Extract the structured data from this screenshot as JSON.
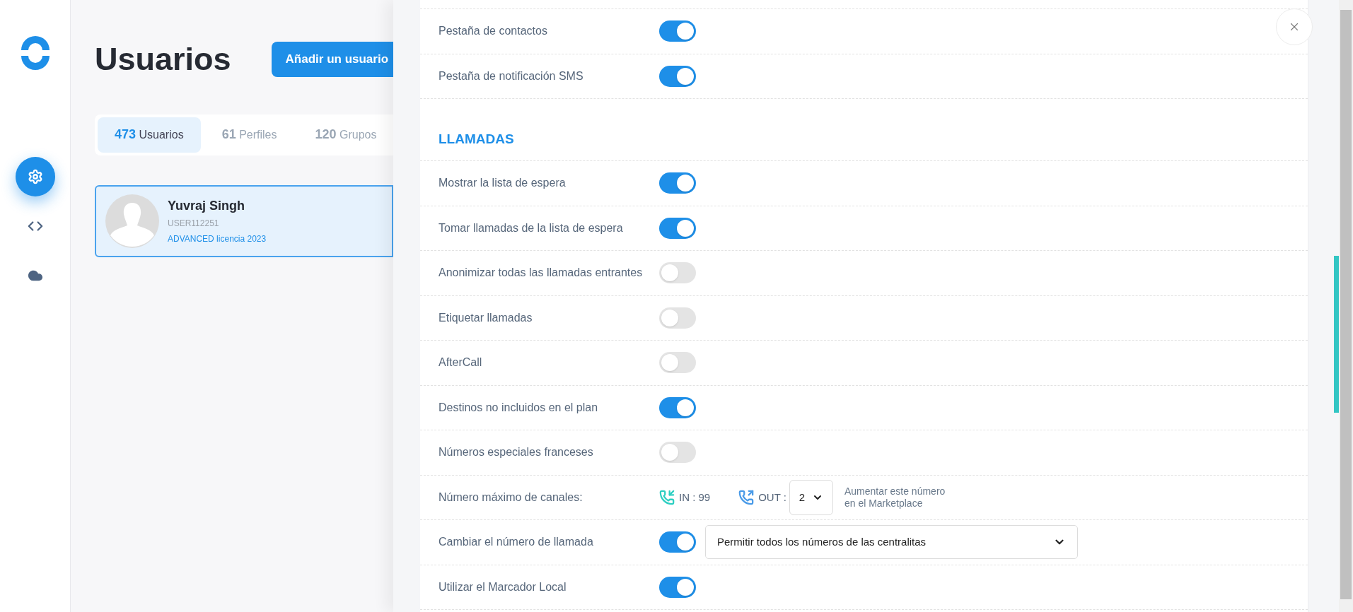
{
  "sidebar": {
    "items": [
      {
        "kind": "settings",
        "selected": true
      },
      {
        "kind": "code",
        "selected": false
      },
      {
        "kind": "cloud",
        "selected": false
      }
    ]
  },
  "page": {
    "title": "Usuarios",
    "add_button": "Añadir un usuario",
    "tabs": [
      {
        "count": "473",
        "label": "Usuarios",
        "selected": true
      },
      {
        "count": "61",
        "label": "Perfiles",
        "selected": false
      },
      {
        "count": "120",
        "label": "Grupos",
        "selected": false
      }
    ],
    "users": [
      {
        "name": "Yuvraj Singh",
        "id": "USER112251",
        "license": "ADVANCED licencia 2023",
        "selected": true
      }
    ]
  },
  "drawer": {
    "rows": [
      {
        "kind": "toggle",
        "label": "Pestaña de contactos",
        "on": true
      },
      {
        "kind": "toggle",
        "label": "Pestaña de notificación SMS",
        "on": true
      },
      {
        "kind": "section",
        "label": "LLAMADAS"
      },
      {
        "kind": "toggle",
        "label": "Mostrar la lista de espera",
        "on": true
      },
      {
        "kind": "toggle",
        "label": "Tomar llamadas de la lista de espera",
        "on": true
      },
      {
        "kind": "toggle",
        "label": "Anonimizar todas las llamadas entrantes",
        "on": false
      },
      {
        "kind": "toggle",
        "label": "Etiquetar llamadas",
        "on": false
      },
      {
        "kind": "toggle",
        "label": "AfterCall",
        "on": false
      },
      {
        "kind": "toggle",
        "label": "Destinos no incluidos en el plan",
        "on": true
      },
      {
        "kind": "toggle",
        "label": "Números especiales franceses",
        "on": false
      },
      {
        "kind": "channels",
        "label": "Número máximo de canales:",
        "in_label": "IN : 99",
        "out_label": "OUT :",
        "out_value": "2",
        "hint": "Aumentar este número\nen el Marketplace"
      },
      {
        "kind": "toggle_select",
        "label": "Cambiar el número de llamada",
        "on": true,
        "select_value": "Permitir todos los números de las centralitas"
      },
      {
        "kind": "toggle",
        "label": "Utilizar el Marcador Local",
        "on": true
      }
    ]
  }
}
